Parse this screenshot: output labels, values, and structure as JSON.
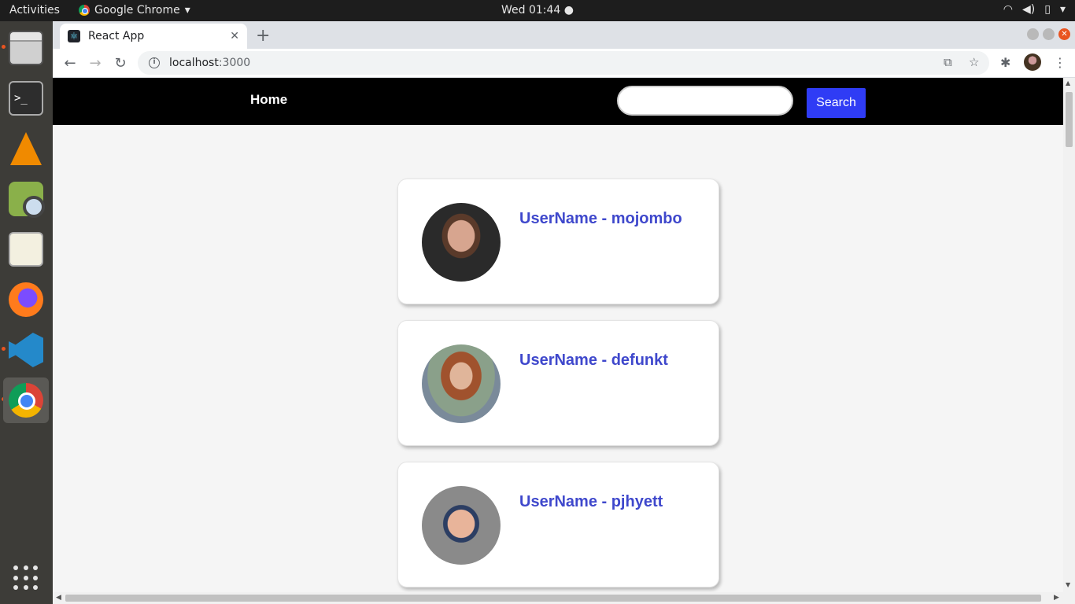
{
  "system": {
    "activities_label": "Activities",
    "app_menu_label": "Google Chrome",
    "clock": "Wed 01:44 ●"
  },
  "browser": {
    "tab_title": "React App",
    "address_host": "localhost",
    "address_port": ":3000"
  },
  "app": {
    "nav_home": "Home",
    "search_value": "",
    "search_button": "Search",
    "users": [
      {
        "label": "UserName - mojombo"
      },
      {
        "label": "UserName - defunkt"
      },
      {
        "label": "UserName - pjhyett"
      }
    ]
  },
  "colors": {
    "navbar_bg": "#000000",
    "search_button_bg": "#2f3cf5",
    "username_text": "#3f48cc",
    "page_bg": "#f5f5f5"
  },
  "icons": {
    "dock": [
      "files-icon",
      "terminal-icon",
      "vlc-icon",
      "image-viewer-icon",
      "text-editor-icon",
      "firefox-icon",
      "vscode-icon",
      "chrome-icon",
      "show-apps-icon"
    ],
    "tray": [
      "wifi-icon",
      "volume-icon",
      "battery-icon",
      "chevron-down-icon"
    ]
  }
}
